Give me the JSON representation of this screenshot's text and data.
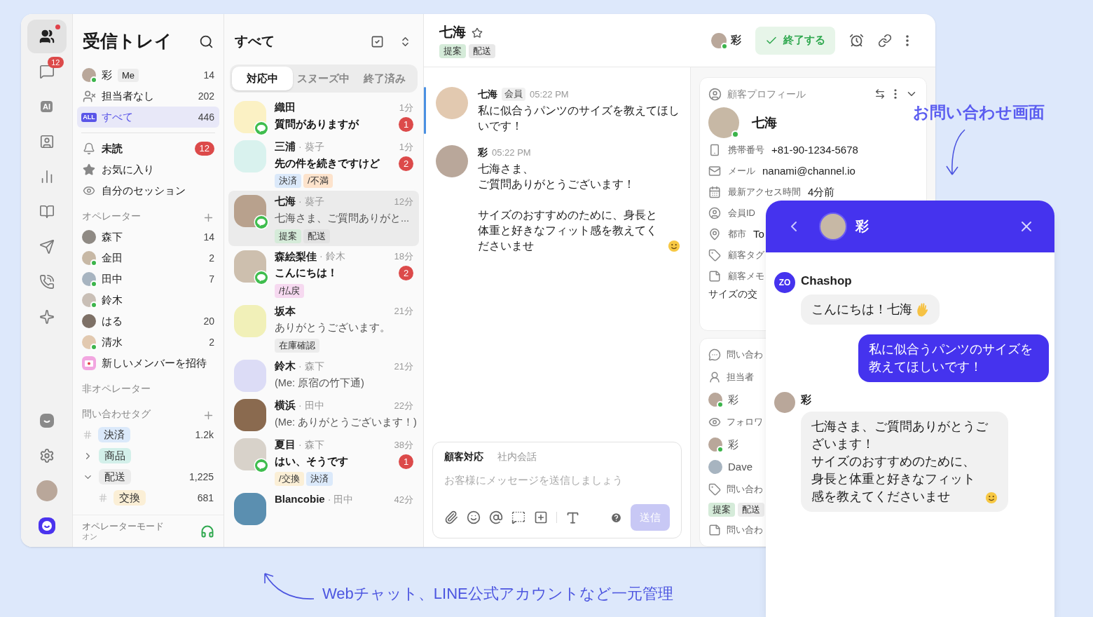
{
  "rail": {
    "top": [
      {
        "kind": "team",
        "selected": true,
        "notify": true
      },
      {
        "kind": "inbox",
        "selected": false,
        "notify": false,
        "badge": "12"
      },
      {
        "kind": "ai",
        "selected": false,
        "notify": false,
        "label": "AI"
      },
      {
        "kind": "contacts",
        "selected": false,
        "notify": false
      },
      {
        "kind": "stats",
        "selected": false,
        "notify": false
      },
      {
        "kind": "docs",
        "selected": false,
        "notify": false
      },
      {
        "kind": "campaign",
        "selected": false,
        "notify": false
      },
      {
        "kind": "call",
        "selected": false,
        "notify": false
      },
      {
        "kind": "sparkle",
        "selected": false,
        "notify": false
      }
    ],
    "bottom": [
      {
        "kind": "app"
      },
      {
        "kind": "settings"
      },
      {
        "kind": "profile"
      },
      {
        "kind": "brand"
      }
    ]
  },
  "sidebar": {
    "title": "受信トレイ",
    "views": [
      {
        "kind": "me",
        "label": "彩",
        "tag": "Me",
        "count": "14",
        "selected": false,
        "online": true
      },
      {
        "kind": "unassigned",
        "label": "担当者なし",
        "count": "202",
        "selected": false
      },
      {
        "kind": "all",
        "icon_text": "ALL",
        "label": "すべて",
        "count": "446",
        "selected": true
      }
    ],
    "filters": [
      {
        "kind": "unread",
        "label": "未読",
        "badge": "12",
        "bold": true
      },
      {
        "kind": "favorite",
        "label": "お気に入り",
        "bold": false
      },
      {
        "kind": "mine",
        "label": "自分のセッション",
        "bold": false
      }
    ],
    "operators_title": "オペレーター",
    "operators": [
      {
        "name": "森下",
        "count": "14",
        "online": false
      },
      {
        "name": "金田",
        "count": "2",
        "online": true
      },
      {
        "name": "田中",
        "count": "7",
        "online": true
      },
      {
        "name": "鈴木",
        "online": true
      },
      {
        "name": "はる",
        "count": "20",
        "online": false
      },
      {
        "name": "清水",
        "count": "2",
        "online": true
      }
    ],
    "invite": "新しいメンバーを招待",
    "non_operators_title": "非オペレーター",
    "tags_title": "問い合わせタグ",
    "tags": [
      {
        "kind": "hash",
        "label": "決済",
        "count": "1.2k",
        "color": "#dbe9fa"
      },
      {
        "kind": "group",
        "label": "商品",
        "expanded": false,
        "color": "#d3f0ea"
      },
      {
        "kind": "group",
        "label": "配送",
        "count": "1,225",
        "expanded": true,
        "color": "#ececec",
        "children": [
          {
            "kind": "hash",
            "label": "交換",
            "count": "681",
            "color": "#fbefd6"
          }
        ]
      }
    ],
    "footer": {
      "title": "オペレーターモード",
      "status": "オン"
    }
  },
  "conversations": {
    "title": "すべて",
    "tabs": [
      {
        "label": "対応中",
        "selected": true
      },
      {
        "label": "スヌーズ中",
        "selected": false
      },
      {
        "label": "終了済み",
        "selected": false
      }
    ],
    "items": [
      {
        "name": "織田",
        "time": "1分",
        "preview": "質問がありますが",
        "unread": true,
        "unread_count": "1",
        "line_badge": true,
        "selected": false
      },
      {
        "name": "三浦",
        "assignee": "· 葵子",
        "time": "1分",
        "preview": "先の件を続きですけど",
        "unread": true,
        "unread_count": "2",
        "line_badge": false,
        "selected": false,
        "tags": [
          {
            "label": "決済",
            "color": "#dbe9fa"
          },
          {
            "label": "/不満",
            "color": "#fde3cc"
          }
        ]
      },
      {
        "name": "七海",
        "assignee": "· 葵子",
        "time": "12分",
        "preview": "七海さま、ご質問ありがと...",
        "unread": false,
        "line_badge": true,
        "selected": true,
        "tags": [
          {
            "label": "提案",
            "color": "#d5ebd9"
          },
          {
            "label": "配送",
            "color": "#e2e2e2"
          }
        ]
      },
      {
        "name": "森絵梨佳",
        "assignee": "· 鈴木",
        "time": "18分",
        "preview": "こんにちは！",
        "unread": true,
        "unread_count": "2",
        "line_badge": true,
        "selected": false,
        "tags": [
          {
            "label": "/払戻",
            "color": "#f6d9f0"
          }
        ]
      },
      {
        "name": "坂本",
        "time": "21分",
        "preview": "ありがとうございます。",
        "unread": false,
        "line_badge": false,
        "selected": false,
        "tags": [
          {
            "label": "在庫確認",
            "color": "#ececec"
          }
        ]
      },
      {
        "name": "鈴木",
        "assignee": "· 森下",
        "time": "21分",
        "preview": "(Me: 原宿の竹下通)",
        "unread": false,
        "line_badge": false,
        "selected": false
      },
      {
        "name": "横浜",
        "assignee": "· 田中",
        "time": "22分",
        "preview": "(Me: ありがとうございます！)",
        "unread": false,
        "line_badge": false,
        "selected": false
      },
      {
        "name": "夏目",
        "assignee": "· 森下",
        "time": "38分",
        "preview": "はい、そうです",
        "unread": true,
        "unread_count": "1",
        "line_badge": true,
        "selected": false,
        "tags": [
          {
            "label": "/交換",
            "color": "#fbefd6"
          },
          {
            "label": "決済",
            "color": "#dbe9fa"
          }
        ]
      },
      {
        "name": "Blancobie",
        "assignee": "· 田中",
        "time": "42分",
        "line_badge": false,
        "selected": false
      }
    ]
  },
  "chat": {
    "title": "七海",
    "starred": false,
    "tags": [
      {
        "label": "提案",
        "color": "#d5ebd9"
      },
      {
        "label": "配送",
        "color": "#e8e8e8"
      }
    ],
    "assignee": "彩",
    "close_button": "終了する",
    "messages": [
      {
        "name": "七海",
        "role": "会員",
        "time": "05:22 PM",
        "paragraphs": [
          [
            "私に似合うパンツのサイズを教えてほしいです！"
          ]
        ],
        "emoji_icon": false,
        "highlighted": true
      },
      {
        "name": "彩",
        "time": "05:22 PM",
        "paragraphs": [
          [
            "七海さま、",
            "ご質問ありがとうございます！"
          ],
          [
            "サイズのおすすめのために、身長と体重と好きなフィット感を教えてくださいませ"
          ]
        ],
        "emoji_icon": true,
        "highlighted": false
      }
    ],
    "composer": {
      "tabs": [
        {
          "label": "顧客対応",
          "selected": true
        },
        {
          "label": "社内会話",
          "selected": false
        }
      ],
      "placeholder": "お客様にメッセージを送信しましょう",
      "send": "送信",
      "send_disabled": true
    }
  },
  "profile": {
    "title": "顧客プロフィール",
    "name": "七海",
    "online": true,
    "fields": [
      {
        "kind": "phone",
        "label": "携帯番号",
        "value": "+81-90-1234-5678"
      },
      {
        "kind": "mail",
        "label": "メール",
        "value": "nanami@channel.io"
      },
      {
        "kind": "calendar",
        "label": "最新アクセス時間",
        "value": "4分前"
      },
      {
        "kind": "member",
        "label": "会員ID"
      },
      {
        "kind": "city",
        "label": "都市",
        "value": "To"
      },
      {
        "kind": "tag",
        "label": "顧客タグ"
      },
      {
        "kind": "memo",
        "label": "顧客メモ"
      }
    ],
    "memo": "サイズの交",
    "details": [
      {
        "kind": "inquiry",
        "label": "問い合わ"
      },
      {
        "kind": "assignee",
        "label": "担当者"
      },
      {
        "kind": "person",
        "label": "彩",
        "online": true
      },
      {
        "kind": "followers",
        "label": "フォロワ"
      },
      {
        "kind": "person",
        "label": "彩",
        "online": true
      },
      {
        "kind": "person",
        "label": "Dave",
        "online": false
      },
      {
        "kind": "inquiry_tags",
        "label": "問い合わ"
      },
      {
        "kind": "tags",
        "tags": [
          {
            "label": "提案",
            "color": "#d5ebd9"
          },
          {
            "label": "配送",
            "color": "#ececec"
          }
        ]
      },
      {
        "kind": "inquiry_memo",
        "label": "問い合わ"
      }
    ]
  },
  "widget": {
    "name": "彩",
    "messages": [
      {
        "kind": "bot",
        "sender": "Chashop",
        "logo_text": "ZO",
        "lines": [
          "こんにちは！七海"
        ],
        "emoji_icon": true
      },
      {
        "kind": "user",
        "lines": [
          "私に似合うパンツのサイズを教えてほしいです！"
        ]
      },
      {
        "kind": "agent",
        "sender": "彩",
        "lines": [
          "七海さま、ご質問ありがとうございます！",
          "サイズのおすすめのために、身長と体重と好きなフィット感を教えてくださいませ"
        ],
        "emoji_icon": true
      }
    ]
  },
  "annotations": {
    "widget": "お問い合わせ画面",
    "inbox": "Webチャット、LINE公式アカウントなど一元管理"
  }
}
